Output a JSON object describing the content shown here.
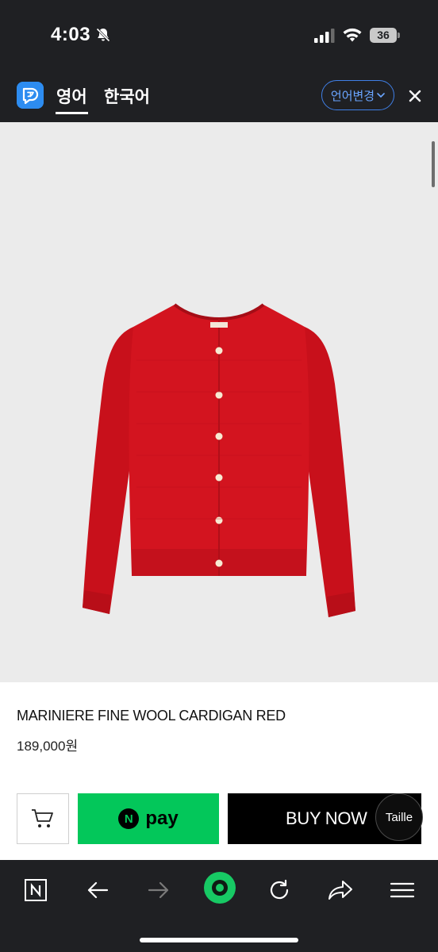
{
  "status_bar": {
    "time": "4:03",
    "battery": "36"
  },
  "translate_bar": {
    "tabs": [
      "영어",
      "한국어"
    ],
    "active_tab": "영어",
    "change_language_label": "언어변경"
  },
  "product": {
    "name": "MARINIERE FINE WOOL CARDIGAN RED",
    "price": "189,000원",
    "color": "#d3141f"
  },
  "actions": {
    "npay_badge": "N",
    "npay_label": "pay",
    "buy_now_label": "BUY NOW",
    "taille_label": "Taille"
  },
  "colors": {
    "dark_bar": "#1f2023",
    "accent_blue": "#3f7fe6",
    "npay_green": "#03c75a",
    "toolbar_green": "#17c964"
  },
  "toolbar": {
    "icons": [
      "tabs-icon",
      "back-arrow-icon",
      "forward-arrow-icon",
      "home-circle-icon",
      "reload-icon",
      "share-icon",
      "menu-icon"
    ]
  }
}
